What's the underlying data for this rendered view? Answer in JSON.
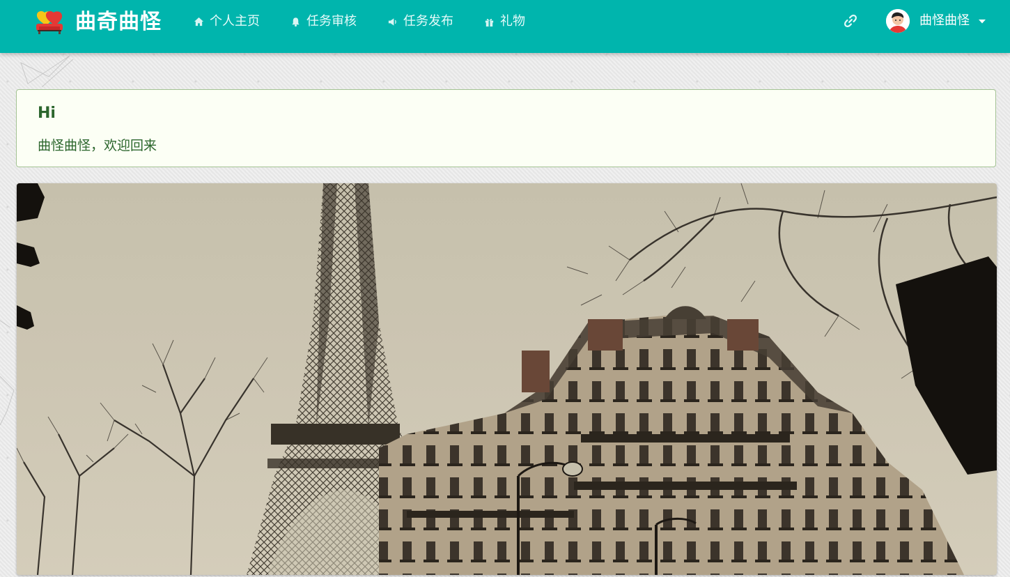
{
  "navbar": {
    "brand": "曲奇曲怪",
    "items": [
      {
        "label": "个人主页",
        "icon": "home-icon"
      },
      {
        "label": "任务审核",
        "icon": "bell-icon"
      },
      {
        "label": "任务发布",
        "icon": "megaphone-icon"
      },
      {
        "label": "礼物",
        "icon": "gift-icon"
      }
    ],
    "link_icon": "link-icon",
    "user": {
      "name": "曲怪曲怪",
      "avatar_icon": "avatar-icon"
    }
  },
  "welcome": {
    "title": "Hi",
    "message": "曲怪曲怪，欢迎回来"
  },
  "banner": {
    "subject": "eiffel-tower-photo"
  },
  "colors": {
    "navbar_bg": "#00b5ad",
    "welcome_bg": "#fcfff5",
    "welcome_border": "#a3c293",
    "welcome_text": "#2c662d"
  }
}
